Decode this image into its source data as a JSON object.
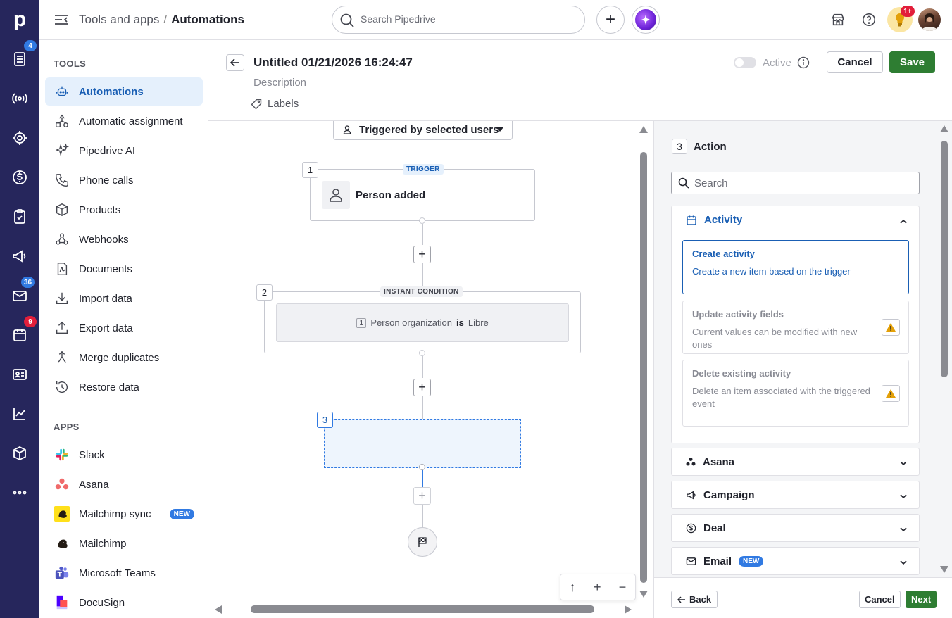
{
  "rail": {
    "logo": "p",
    "items": [
      {
        "icon": "leads-inbox-icon",
        "badge": "4"
      },
      {
        "icon": "broadcast-icon",
        "badge": ""
      },
      {
        "icon": "target-icon",
        "badge": ""
      },
      {
        "icon": "dollar-icon",
        "badge": ""
      },
      {
        "icon": "clipboard-check-icon",
        "badge": ""
      },
      {
        "icon": "megaphone-icon",
        "badge": ""
      },
      {
        "icon": "mail-icon",
        "badge": "36"
      },
      {
        "icon": "calendar-icon",
        "badge": "9"
      },
      {
        "icon": "contact-card-icon",
        "badge": ""
      },
      {
        "icon": "chart-icon",
        "badge": ""
      },
      {
        "icon": "box-icon",
        "badge": ""
      },
      {
        "icon": "more-icon",
        "badge": ""
      }
    ]
  },
  "topbar": {
    "breadcrumb_parent": "Tools and apps",
    "breadcrumb_sep": "/",
    "breadcrumb_current": "Automations",
    "search_placeholder": "Search Pipedrive",
    "plus_label": "+",
    "notification_badge": "1+"
  },
  "sidebar": {
    "tools_heading": "TOOLS",
    "tools": [
      {
        "label": "Automations",
        "active": true
      },
      {
        "label": "Automatic assignment"
      },
      {
        "label": "Pipedrive AI"
      },
      {
        "label": "Phone calls"
      },
      {
        "label": "Products"
      },
      {
        "label": "Webhooks"
      },
      {
        "label": "Documents"
      },
      {
        "label": "Import data"
      },
      {
        "label": "Export data"
      },
      {
        "label": "Merge duplicates"
      },
      {
        "label": "Restore data"
      }
    ],
    "apps_heading": "APPS",
    "apps": [
      {
        "label": "Slack"
      },
      {
        "label": "Asana"
      },
      {
        "label": "Mailchimp sync",
        "badge": "NEW"
      },
      {
        "label": "Mailchimp"
      },
      {
        "label": "Microsoft Teams"
      },
      {
        "label": "DocuSign"
      }
    ]
  },
  "header": {
    "title": "Untitled 01/21/2026 16:24:47",
    "description": "Description",
    "labels": "Labels",
    "active_label": "Active",
    "cancel": "Cancel",
    "save": "Save"
  },
  "canvas": {
    "trigger_select": "Triggered by selected users",
    "step1": {
      "num": "1",
      "pill": "TRIGGER",
      "label": "Person added"
    },
    "step2": {
      "num": "2",
      "pill": "INSTANT CONDITION",
      "cond_num": "1",
      "cond_field": "Person organization",
      "cond_op": "is",
      "cond_value": "Libre"
    },
    "step3": {
      "num": "3"
    },
    "add": "+",
    "zoom": {
      "up": "↑",
      "plus": "+",
      "minus": "−"
    }
  },
  "panel": {
    "step_num": "3",
    "title": "Action",
    "search_placeholder": "Search",
    "open_category": "Activity",
    "options": [
      {
        "title": "Create activity",
        "desc": "Create a new item based on the trigger"
      },
      {
        "title": "Update activity fields",
        "desc": "Current values can be modified with new ones"
      },
      {
        "title": "Delete existing activity",
        "desc": "Delete an item associated with the triggered event"
      }
    ],
    "categories": [
      "Asana",
      "Campaign",
      "Deal",
      "Email"
    ],
    "email_badge": "NEW",
    "back": "Back",
    "cancel": "Cancel",
    "next": "Next"
  },
  "colors": {
    "rail": "#26265c",
    "accent_blue": "#1a5fb4",
    "save_green": "#2e7d32",
    "badge_blue": "#317ae2",
    "badge_red": "#e21e3a"
  }
}
